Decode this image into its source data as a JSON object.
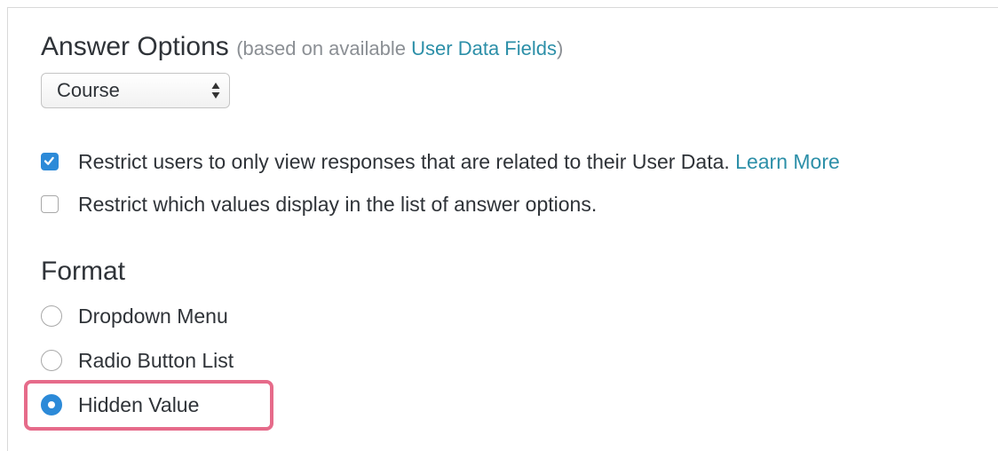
{
  "answer_options": {
    "title": "Answer Options",
    "note_prefix": "(based on available ",
    "link": "User Data Fields",
    "note_suffix": ")"
  },
  "select": {
    "value": "Course"
  },
  "restrictions": {
    "restrict_view": {
      "checked": true,
      "label": "Restrict users to only view responses that are related to their User Data.",
      "link": "Learn More"
    },
    "restrict_values": {
      "checked": false,
      "label": "Restrict which values display in the list of answer options."
    }
  },
  "format": {
    "title": "Format",
    "options": [
      {
        "label": "Dropdown Menu",
        "selected": false
      },
      {
        "label": "Radio Button List",
        "selected": false
      },
      {
        "label": "Hidden Value",
        "selected": true
      }
    ]
  },
  "colors": {
    "accent": "#2c8ad8",
    "link": "#2c8fa8",
    "highlight": "#e66b8a"
  },
  "icons": {
    "select_arrows": "up-down-arrows-icon",
    "checkbox_checked": "checkmark-icon"
  }
}
